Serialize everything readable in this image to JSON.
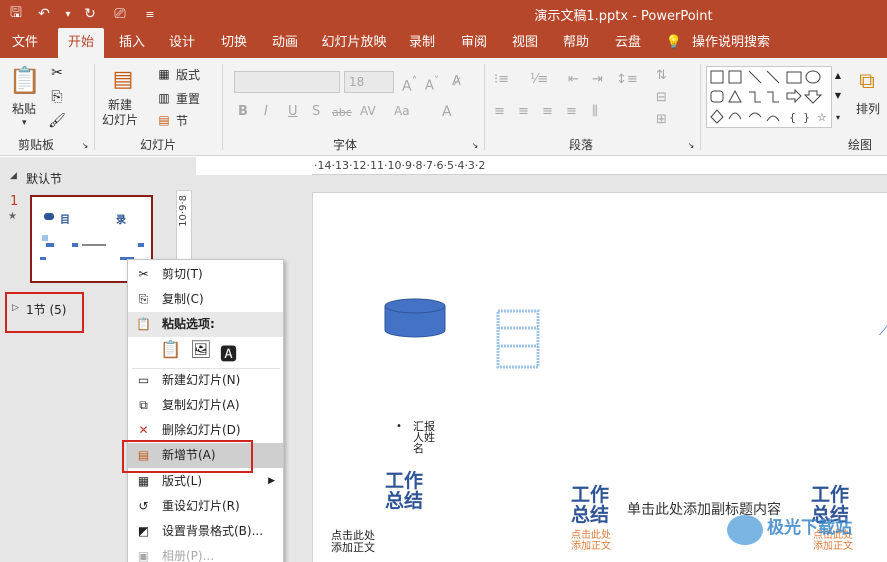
{
  "window": {
    "title": "演示文稿1.pptx  -  PowerPoint"
  },
  "qat": [
    {
      "name": "save-icon",
      "glyph": "🖫"
    },
    {
      "name": "undo-icon",
      "glyph": "↶"
    },
    {
      "name": "redo-icon",
      "glyph": "↻"
    },
    {
      "name": "present-icon",
      "glyph": "⎚"
    },
    {
      "name": "customize-qat-icon",
      "glyph": "≡"
    }
  ],
  "tabs": [
    "文件",
    "开始",
    "插入",
    "设计",
    "切换",
    "动画",
    "幻灯片放映",
    "录制",
    "审阅",
    "视图",
    "帮助",
    "云盘",
    "操作说明搜索"
  ],
  "active_tab": "开始",
  "ribbon": {
    "clipboard": {
      "label": "剪贴板",
      "paste": "粘贴"
    },
    "slides": {
      "label": "幻灯片",
      "new_slide": "新建\n幻灯片",
      "layout": "版式",
      "reset": "重置",
      "section": "节"
    },
    "font": {
      "label": "字体",
      "font_name": "",
      "font_size": "18"
    },
    "paragraph": {
      "label": "段落"
    },
    "drawing": {
      "label": "绘图",
      "arrange": "排列"
    }
  },
  "thumbnail_pane": {
    "default_section": "默认节",
    "slide_number": "1",
    "slide_star": "★",
    "thumb_title_left": "目",
    "thumb_title_right": "录",
    "section1": "1节 (5)"
  },
  "ruler": {
    "horizontal": "·14·13·12·11·10·9·8·7·6·5·4·3·2",
    "vertical": "10·9·8"
  },
  "slide": {
    "bullet_text": "汇报\n人姓\n名",
    "title_art": "工作\n总结",
    "subtitle_prompt": "单击此处添加副标题内容",
    "body_prompt_left": "点击此处\n添加正文",
    "body_prompt_mid": "点击此处\n添加正文",
    "body_prompt_right": "点击此处\n添加正文",
    "watermark": "极光下载站"
  },
  "context_menu": {
    "items": [
      {
        "label": "剪切(T)",
        "icon": "cut-icon",
        "glyph": "✂",
        "disabled": false
      },
      {
        "label": "复制(C)",
        "icon": "copy-icon",
        "glyph": "⎘",
        "disabled": false
      },
      {
        "label": "粘贴选项:",
        "icon": "paste-options-icon",
        "glyph": "",
        "disabled": false,
        "header": true
      },
      {
        "label": "新建幻灯片(N)",
        "icon": "new-slide-icon",
        "glyph": "▭",
        "disabled": false
      },
      {
        "label": "复制幻灯片(A)",
        "icon": "duplicate-slide-icon",
        "glyph": "⧉",
        "disabled": false
      },
      {
        "label": "删除幻灯片(D)",
        "icon": "delete-slide-icon",
        "glyph": "✕",
        "disabled": false
      },
      {
        "label": "新增节(A)",
        "icon": "add-section-icon",
        "glyph": "▤",
        "disabled": false,
        "highlight": true
      },
      {
        "label": "版式(L)",
        "icon": "layout-icon",
        "glyph": "▦",
        "disabled": false,
        "submenu": true
      },
      {
        "label": "重设幻灯片(R)",
        "icon": "reset-slide-icon",
        "glyph": "↺",
        "disabled": false
      },
      {
        "label": "设置背景格式(B)...",
        "icon": "format-background-icon",
        "glyph": "◩",
        "disabled": false
      },
      {
        "label": "相册(P)...",
        "icon": "photo-album-icon",
        "glyph": "▣",
        "disabled": true
      }
    ]
  },
  "colors": {
    "accent": "#b7472a",
    "highlight_box": "#d0251e",
    "thumb_border": "#8b1a1a",
    "art_blue": "#2f5597",
    "prompt_orange": "#e07b39"
  }
}
